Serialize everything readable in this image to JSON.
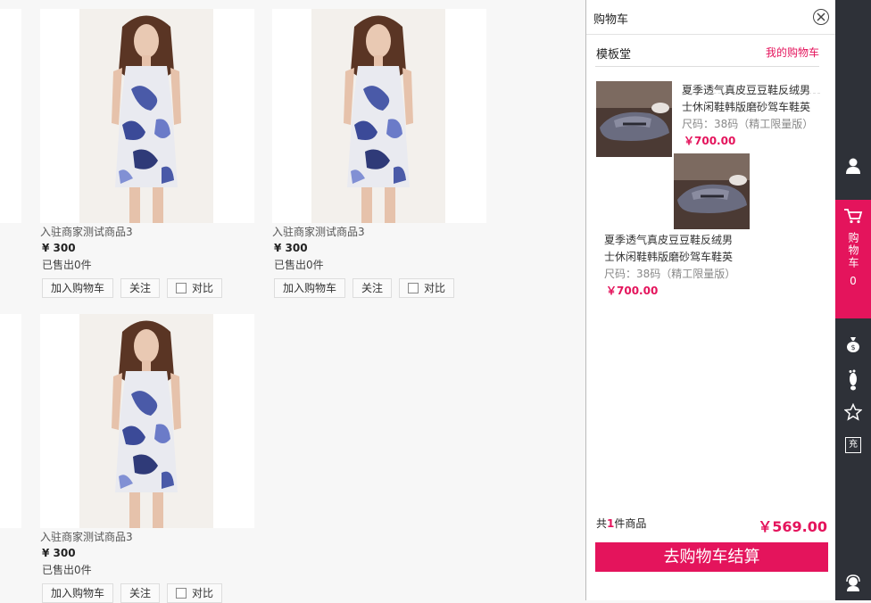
{
  "products": [
    {
      "name": "入驻商家测试商品3",
      "price": "¥ 300",
      "sold": "已售出0件",
      "add_cart": "加入购物车",
      "follow": "关注",
      "compare": "对比"
    },
    {
      "name": "入驻商家测试商品3",
      "price": "¥ 300",
      "sold": "已售出0件",
      "add_cart": "加入购物车",
      "follow": "关注",
      "compare": "对比"
    },
    {
      "name": "入驻商家测试商品3",
      "price": "¥ 300",
      "sold": "已售出0件",
      "add_cart": "加入购物车",
      "follow": "关注",
      "compare": "对比"
    }
  ],
  "cart": {
    "title": "购物车",
    "shop_name": "模板堂",
    "my_cart_link": "我的购物车",
    "items": [
      {
        "title": "夏季透气真皮豆豆鞋反绒男士休闲鞋韩版磨砂驾车鞋英",
        "spec": "尺码：38码（精工限量版）",
        "price": "￥700.00"
      },
      {
        "title": "夏季透气真皮豆豆鞋反绒男士休闲鞋韩版磨砂驾车鞋英",
        "spec": "尺码：38码（精工限量版）",
        "price": "￥700.00"
      }
    ],
    "count_prefix": "共",
    "count": "1",
    "count_suffix": "件商品",
    "total": "￥569.00",
    "checkout": "去购物车结算"
  },
  "rail": {
    "cart_label": "购物车",
    "cart_count": "0",
    "recharge_glyph": "充"
  },
  "icons": [
    "user-icon",
    "cart-icon",
    "money-bag-icon",
    "footprint-icon",
    "star-icon",
    "recharge-icon",
    "customer-service-icon",
    "close-icon"
  ],
  "colors": {
    "accent": "#e4145c",
    "rail": "#2e3138"
  }
}
